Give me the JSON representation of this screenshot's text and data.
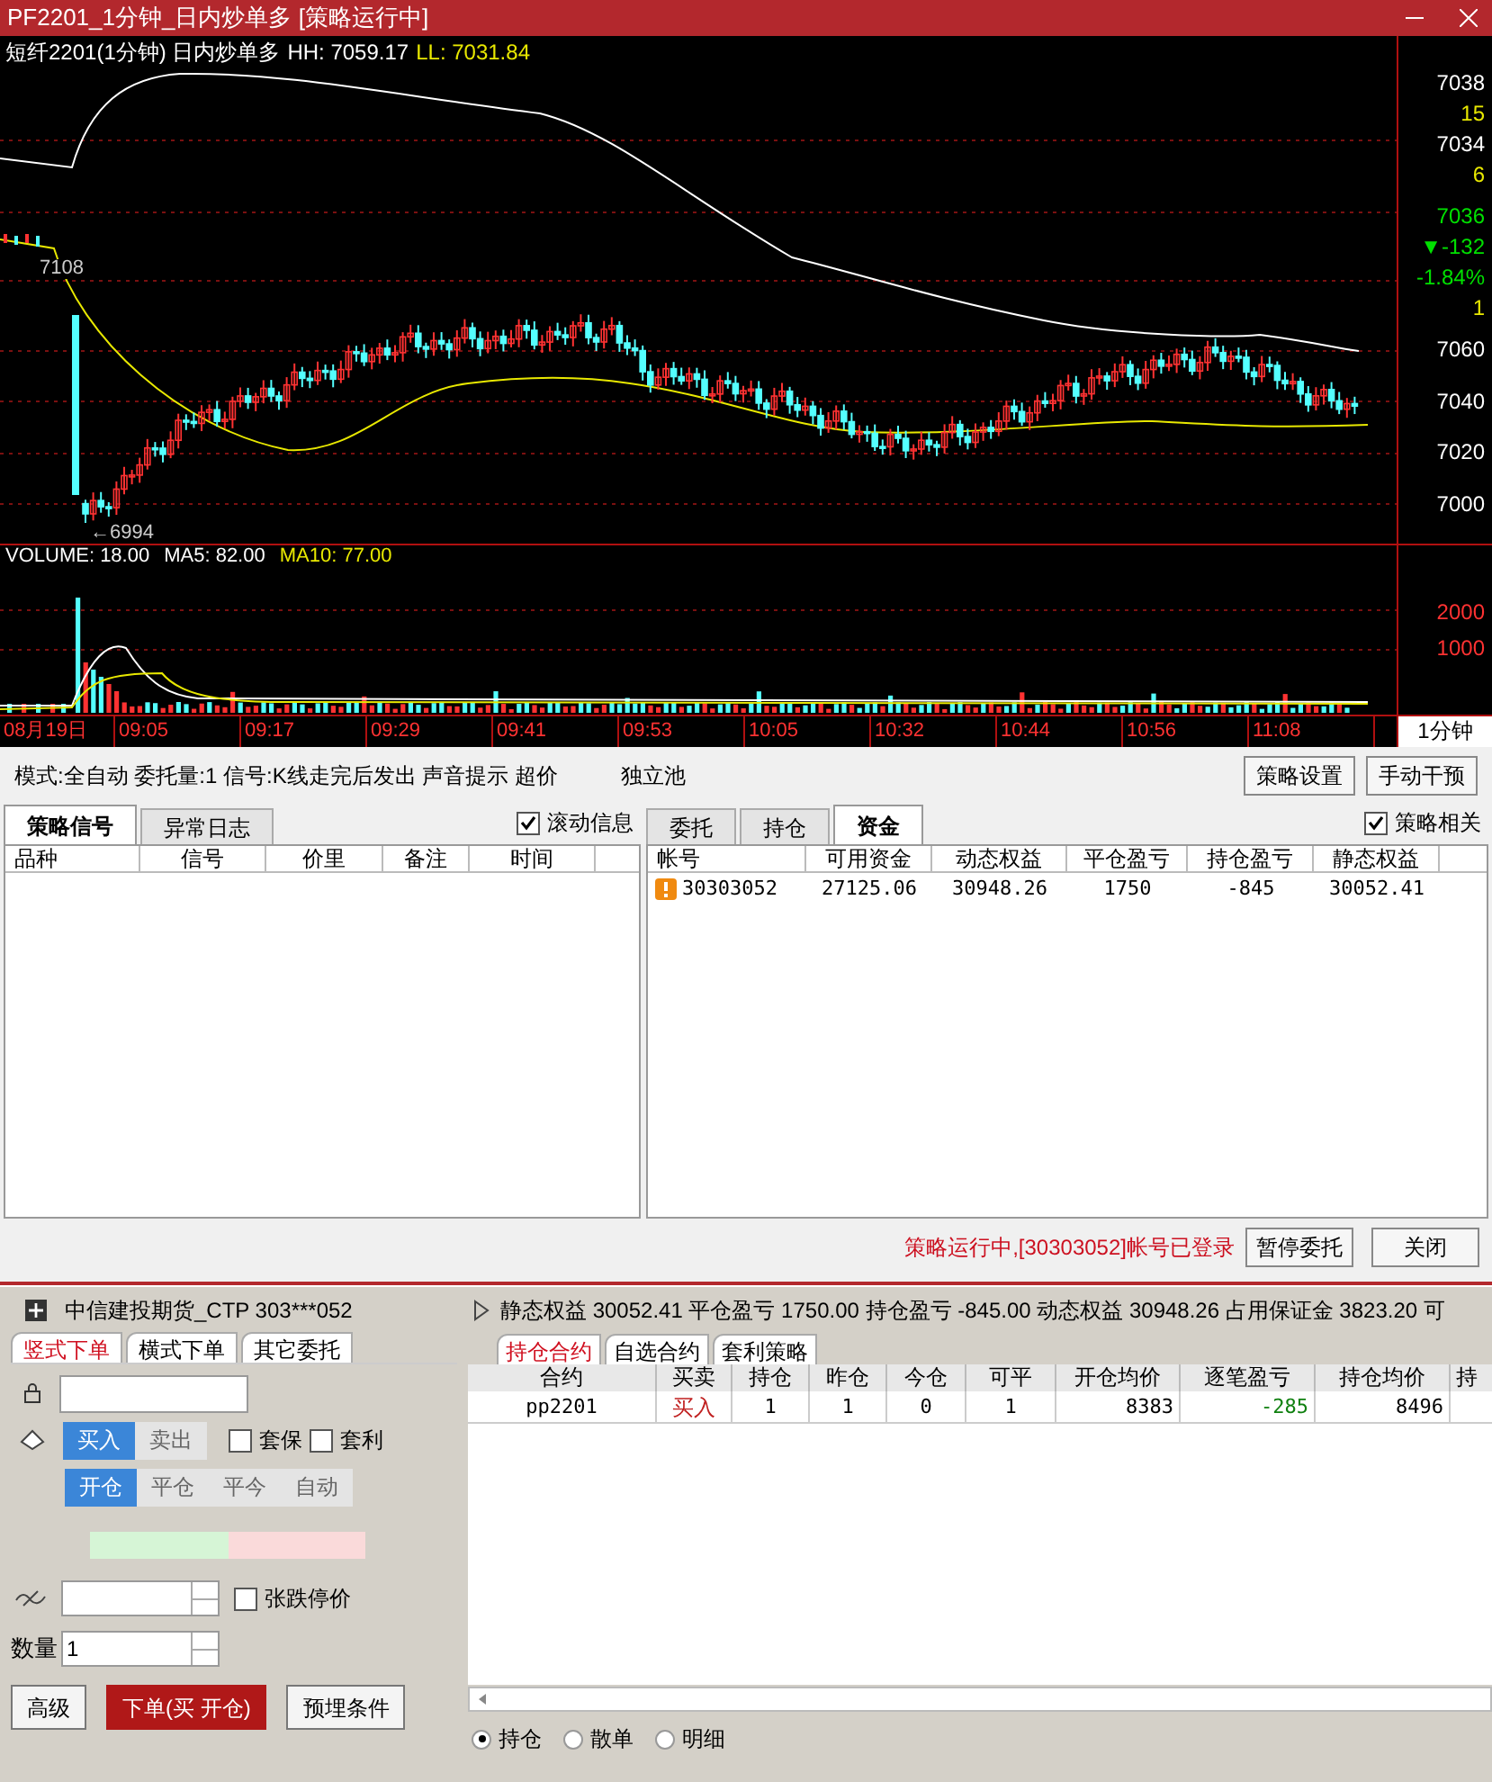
{
  "window": {
    "title": "PF2201_1分钟_日内炒单多 [策略运行中]"
  },
  "chart": {
    "header": {
      "symbol": "短纤2201(1分钟) 日内炒单多",
      "hh": "HH: 7059.17",
      "ll": "LL: 7031.84"
    },
    "quote": [
      {
        "text": "7038",
        "color": "#ffffff"
      },
      {
        "text": "15",
        "color": "#e8e800"
      },
      {
        "text": "7034",
        "color": "#ffffff"
      },
      {
        "text": "6",
        "color": "#e8e800"
      },
      {
        "text": "7036",
        "color": "#00e000"
      },
      {
        "text": "▼-132",
        "color": "#00e000"
      },
      {
        "text": "-1.84%",
        "color": "#00e000"
      },
      {
        "text": "1",
        "color": "#e8e800"
      }
    ],
    "price_axis": [
      "7060",
      "7040",
      "7020",
      "7000"
    ],
    "high_marker": "7108",
    "low_marker": "←6994",
    "volume": {
      "volume": "VOLUME: 18.00",
      "ma5": "MA5: 82.00",
      "ma10": "MA10: 77.00",
      "axis": [
        "2000",
        "1000"
      ]
    },
    "time_axis": [
      "08月19日",
      "09:05",
      "09:17",
      "09:29",
      "09:41",
      "09:53",
      "10:05",
      "10:32",
      "10:44",
      "10:56",
      "11:08"
    ],
    "period": "1分钟"
  },
  "strategy_bar": {
    "info": "模式:全自动 委托量:1 信号:K线走完后发出 声音提示 超价",
    "pool": "独立池",
    "buttons": [
      "策略设置",
      "手动干预"
    ]
  },
  "signal_panel": {
    "tabs": [
      {
        "label": "策略信号",
        "selected": true
      },
      {
        "label": "异常日志",
        "selected": false
      }
    ],
    "checkbox": {
      "label": "滚动信息",
      "checked": true
    },
    "columns": [
      "品种",
      "信号",
      "价里",
      "备注",
      "时间"
    ]
  },
  "account_panel": {
    "tabs": [
      {
        "label": "委托",
        "selected": false
      },
      {
        "label": "持仓",
        "selected": false
      },
      {
        "label": "资金",
        "selected": true
      }
    ],
    "checkbox": {
      "label": "策略相关",
      "checked": true
    },
    "columns": [
      "帐号",
      "可用资金",
      "动态权益",
      "平仓盈亏",
      "持仓盈亏",
      "静态权益"
    ],
    "rows": [
      [
        "30303052",
        "27125.06",
        "30948.26",
        "1750",
        "-845",
        "30052.41"
      ]
    ]
  },
  "status": {
    "text": "策略运行中,[30303052]帐号已登录",
    "buttons": [
      "暂停委托",
      "关闭"
    ]
  },
  "trade": {
    "broker": "中信建投期货_CTP 303***052",
    "summary": "静态权益 30052.41 平仓盈亏 1750.00 持仓盈亏 -845.00 动态权益 30948.26 占用保证金 3823.20 可",
    "order_tabs": [
      {
        "label": "竖式下单",
        "selected": true
      },
      {
        "label": "横式下单",
        "selected": false
      },
      {
        "label": "其它委托",
        "selected": false
      }
    ],
    "direction": [
      {
        "label": "买入",
        "selected": true
      },
      {
        "label": "卖出",
        "selected": false
      }
    ],
    "flags": [
      {
        "label": "套保",
        "checked": false
      },
      {
        "label": "套利",
        "checked": false
      }
    ],
    "offset": [
      {
        "label": "开仓",
        "selected": true
      },
      {
        "label": "平仓",
        "selected": false
      },
      {
        "label": "平今",
        "selected": false
      },
      {
        "label": "自动",
        "selected": false
      }
    ],
    "limit_checkbox": {
      "label": "张跌停价",
      "checked": false
    },
    "quantity": {
      "label": "数量",
      "value": "1"
    },
    "buttons": [
      {
        "label": "高级",
        "kind": "plain"
      },
      {
        "label": "下单(买 开仓)",
        "kind": "submit"
      },
      {
        "label": "预埋条件",
        "kind": "plain"
      }
    ],
    "position_tabs": [
      {
        "label": "持仓合约",
        "selected": true
      },
      {
        "label": "自选合约",
        "selected": false
      },
      {
        "label": "套利策略",
        "selected": false
      }
    ],
    "columns": [
      "合约",
      "买卖",
      "持仓",
      "昨仓",
      "今仓",
      "可平",
      "开仓均价",
      "逐笔盈亏",
      "持仓均价",
      "持"
    ],
    "rows": [
      [
        "pp2201",
        "买入",
        "1",
        "1",
        "0",
        "1",
        "8383",
        "-285",
        "8496"
      ]
    ],
    "views": [
      {
        "label": "持仓",
        "selected": true
      },
      {
        "label": "散单",
        "selected": false
      },
      {
        "label": "明细",
        "selected": false
      }
    ]
  }
}
